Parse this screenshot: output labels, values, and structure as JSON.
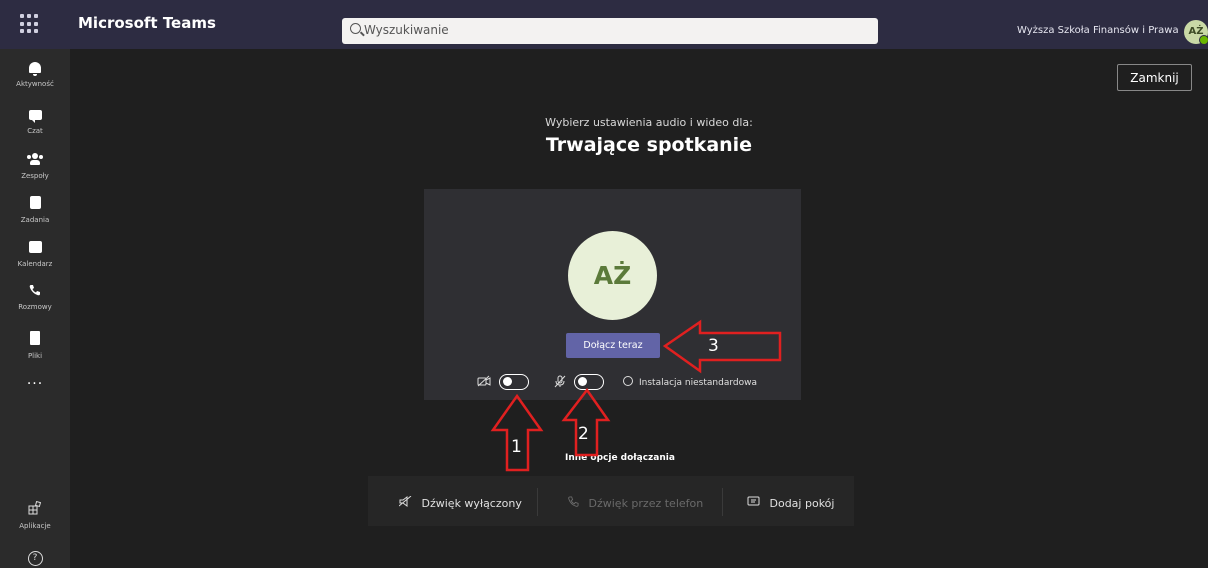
{
  "header": {
    "app_title": "Microsoft Teams",
    "search_placeholder": "Wyszukiwanie",
    "org_name": "Wyższa Szkoła Finansów i Prawa",
    "avatar_initials": "AŻ"
  },
  "rail": {
    "items": [
      {
        "label": "Aktywność",
        "icon": "bell-icon"
      },
      {
        "label": "Czat",
        "icon": "chat-icon"
      },
      {
        "label": "Zespoły",
        "icon": "teams-icon"
      },
      {
        "label": "Zadania",
        "icon": "tasks-icon"
      },
      {
        "label": "Kalendarz",
        "icon": "calendar-icon"
      },
      {
        "label": "Rozmowy",
        "icon": "phone-icon"
      },
      {
        "label": "Pliki",
        "icon": "file-icon"
      }
    ],
    "more": "...",
    "apps_label": "Aplikacje"
  },
  "main": {
    "close_label": "Zamknij",
    "subtitle": "Wybierz ustawienia audio i wideo dla:",
    "title": "Trwające spotkanie",
    "avatar_initials": "AŻ",
    "join_label": "Dołącz teraz",
    "custom_setup_label": "Instalacja niestandardowa",
    "other_options_label": "Inne opcje dołączania",
    "options": {
      "audio_off": "Dźwięk wyłączony",
      "phone_audio": "Dźwięk przez telefon",
      "add_room": "Dodaj pokój"
    }
  },
  "annotations": {
    "one": "1",
    "two": "2",
    "three": "3"
  },
  "colors": {
    "topbar": "#2d2c42",
    "accent": "#6264a7",
    "background": "#1f1f1f",
    "annotation_arrow": "#e02020"
  }
}
